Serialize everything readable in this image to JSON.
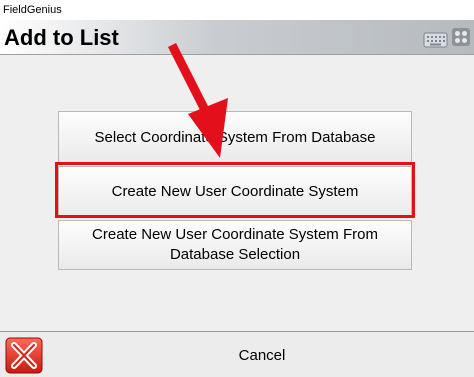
{
  "window": {
    "title": "FieldGenius"
  },
  "header": {
    "title": "Add to List",
    "keyboard_icon": "keyboard-icon",
    "menu_icon": "menu-grid-icon"
  },
  "options": [
    {
      "label": "Select Coordinate System From Database"
    },
    {
      "label": "Create New User Coordinate System",
      "highlighted": true
    },
    {
      "label": "Create New User Coordinate System From Database Selection"
    }
  ],
  "annotation": {
    "arrow_color": "#e3101c",
    "box_color": "#e3101c"
  },
  "footer": {
    "close_icon": "close-x-icon",
    "cancel_label": "Cancel"
  }
}
